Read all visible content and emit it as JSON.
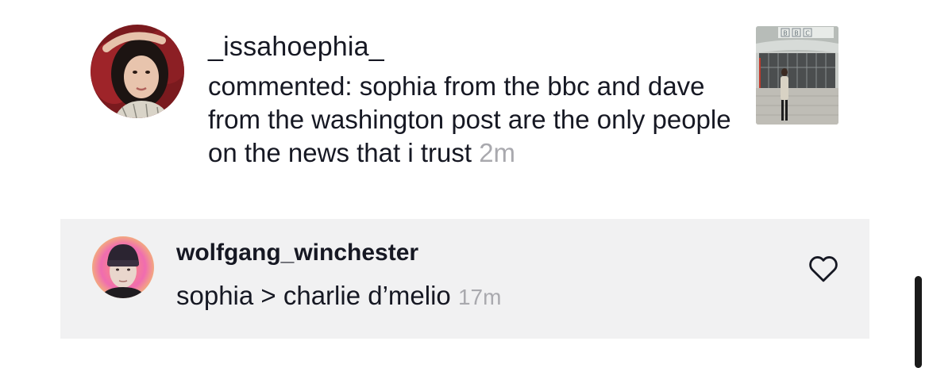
{
  "notification": {
    "username": "_issahoephia_",
    "text": "commented: sophia from the bbc and dave from the washington post are the only people on the news that i trust",
    "time": "2m",
    "thumbnail_sign": "BBC"
  },
  "reply": {
    "username": "wolfgang_winchester",
    "text": "sophia > charlie d’melio",
    "time": "17m"
  },
  "colors": {
    "text_primary": "#161823",
    "text_secondary": "#a9a9ae",
    "card_background": "#f1f1f2",
    "page_background": "#ffffff"
  },
  "icons": {
    "like": "heart-outline-icon"
  }
}
